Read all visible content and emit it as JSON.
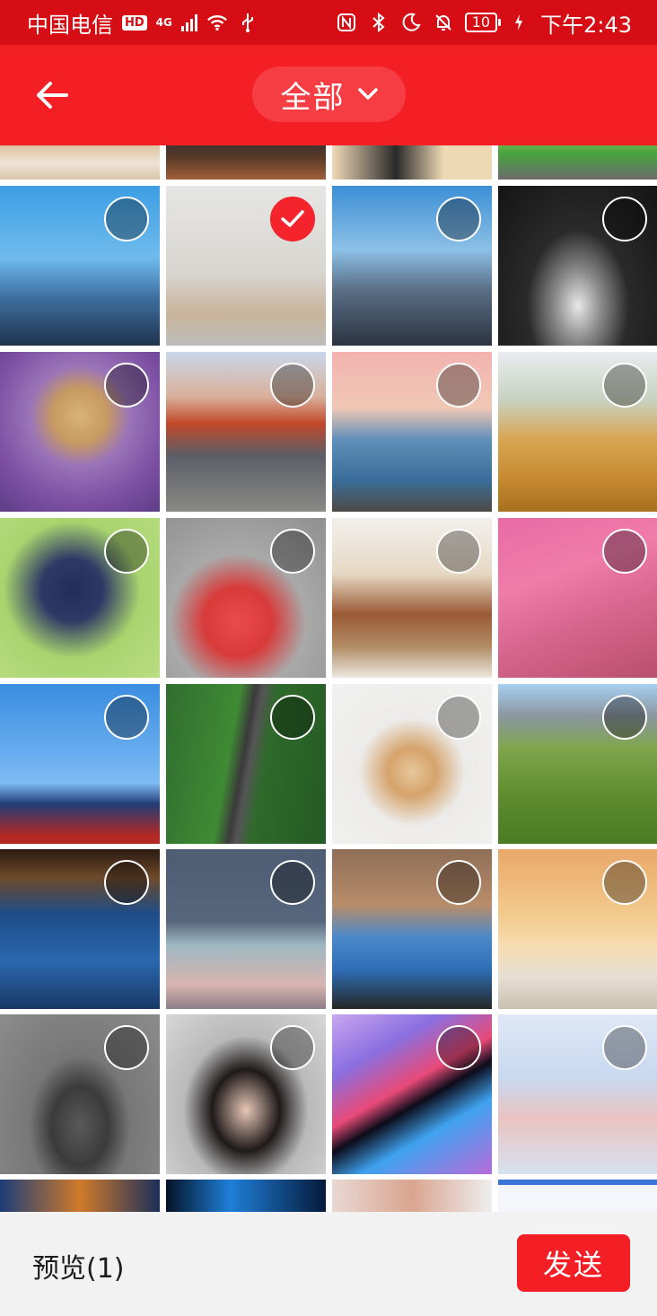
{
  "status_bar": {
    "carrier": "中国电信",
    "hd_badge": "HD",
    "network": "4G",
    "battery": "10",
    "time": "下午2:43"
  },
  "header": {
    "album_title": "全部"
  },
  "footer": {
    "preview_label": "预览(1)",
    "send_label": "发送"
  },
  "selected_count": 1
}
